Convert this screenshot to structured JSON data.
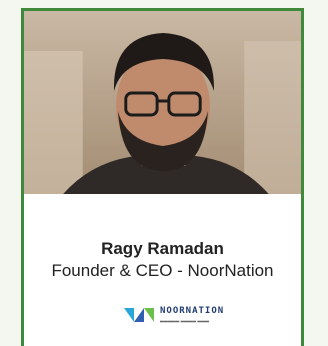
{
  "profile": {
    "name": "Ragy Ramadan",
    "role": "Founder & CEO - NoorNation"
  },
  "logo": {
    "wordmark": "NOORNATION",
    "icon": "noornation-logo-icon"
  },
  "colors": {
    "border": "#3f8a3a",
    "page_bg": "#f4f7ef"
  }
}
